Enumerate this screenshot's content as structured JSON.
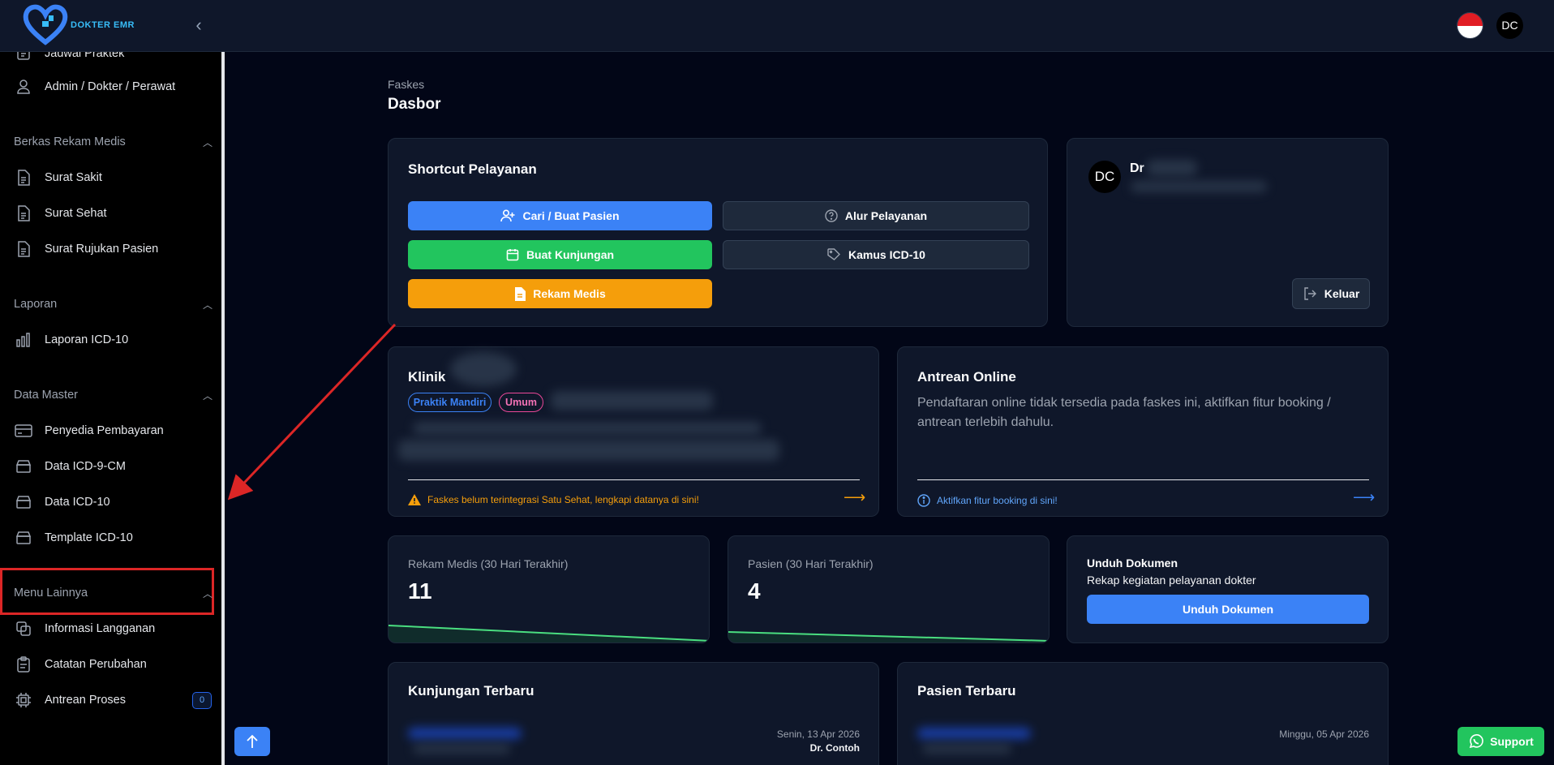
{
  "app": {
    "logo_text": "DOKTER EMR",
    "avatar_initials": "DC"
  },
  "sidebar": {
    "top_items": [
      {
        "label": "Jadwal Praktek",
        "icon": "calendar-edit-icon"
      },
      {
        "label": "Admin / Dokter / Perawat",
        "icon": "user-icon"
      }
    ],
    "sections": [
      {
        "title": "Berkas Rekam Medis",
        "items": [
          "Surat Sakit",
          "Surat Sehat",
          "Surat Rujukan Pasien"
        ]
      },
      {
        "title": "Laporan",
        "items": [
          "Laporan ICD-10"
        ]
      },
      {
        "title": "Data Master",
        "items": [
          "Penyedia Pembayaran",
          "Data ICD-9-CM",
          "Data ICD-10",
          "Template ICD-10"
        ]
      },
      {
        "title": "Menu Lainnya",
        "items": [
          "Informasi Langganan",
          "Catatan Perubahan",
          "Antrean Proses"
        ]
      }
    ],
    "antrean_badge": "0"
  },
  "page": {
    "breadcrumb": "Faskes",
    "title": "Dasbor"
  },
  "shortcut": {
    "title": "Shortcut Pelayanan",
    "buttons": {
      "cari": "Cari / Buat Pasien",
      "alur": "Alur Pelayanan",
      "kunjungan": "Buat Kunjungan",
      "kamus": "Kamus ICD-10",
      "rekam": "Rekam Medis"
    }
  },
  "profile": {
    "avatar": "DC",
    "name": "Dr",
    "logout": "Keluar"
  },
  "klinik": {
    "title": "Klinik",
    "badges": [
      "Praktik Mandiri",
      "Umum"
    ],
    "warning": "Faskes belum terintegrasi Satu Sehat, lengkapi datanya di sini!"
  },
  "antrean": {
    "title": "Antrean Online",
    "description": "Pendaftaran online tidak tersedia pada faskes ini, aktifkan fitur booking / antrean terlebih dahulu.",
    "link": "Aktifkan fitur booking di sini!"
  },
  "stats": {
    "rekam": {
      "label": "Rekam Medis (30 Hari Terakhir)",
      "value": "11"
    },
    "pasien": {
      "label": "Pasien (30 Hari Terakhir)",
      "value": "4"
    }
  },
  "unduh": {
    "title": "Unduh Dokumen",
    "subtitle": "Rekap kegiatan pelayanan dokter",
    "button": "Unduh Dokumen"
  },
  "kunjungan": {
    "title": "Kunjungan Terbaru",
    "date": "Senin, 13 Apr 2026",
    "doctor": "Dr. Contoh"
  },
  "pasien_terbaru": {
    "title": "Pasien Terbaru",
    "date": "Minggu, 05 Apr 2026"
  },
  "support": "Support",
  "colors": {
    "primary": "#3b82f6",
    "success": "#22c55e",
    "warning": "#f59e0b",
    "highlight": "#dc2626"
  }
}
